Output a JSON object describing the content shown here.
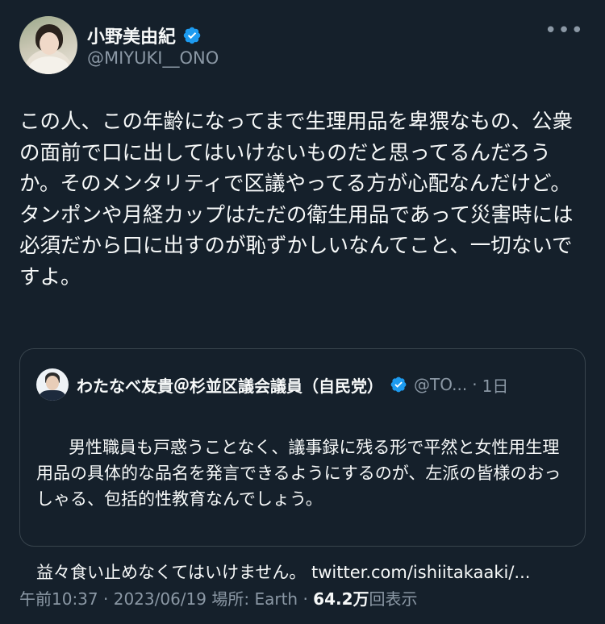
{
  "author": {
    "display_name": "小野美由紀",
    "handle": "@MIYUKI__ONO",
    "verified_icon": "verified-badge-icon",
    "avatar": "author-avatar"
  },
  "more_label": "•••",
  "tweet": {
    "text": "この人、この年齢になってまで生理用品を卑猥なもの、公衆の面前で口に出してはいけないものだと思ってるんだろうか。そのメンタリティで区議やってる方が心配なんだけど。タンポンや月経カップはただの衛生用品であって災害時には必須だから口に出すのが恥ずかしいなんてこと、一切ないですよ。"
  },
  "quote": {
    "display_name": "わたなべ友貴＠杉並区議会議員（自民党）",
    "handle": "@TO...",
    "separator": "·",
    "time": "1日",
    "text": "男性職員も戸惑うことなく、議事録に残る形で平然と女性用生理用品の具体的な品名を発言できるようにするのが、左派の皆様のおっしゃる、包括的性教育なんでしょう。",
    "text2": "益々食い止めなくてはいけません。 twitter.com/ishiitakaaki/..."
  },
  "meta": {
    "time": "午前10:37",
    "sep1": " · ",
    "date": "2023/06/19",
    "location_label": " 場所: Earth",
    "sep2": " · ",
    "views_count": "64.2万",
    "views_label": "回表示"
  },
  "colors": {
    "background": "#15202b",
    "text": "#f7f9f9",
    "secondary": "#8b98a5",
    "verified": "#1d9bf0",
    "border": "#38444d"
  }
}
